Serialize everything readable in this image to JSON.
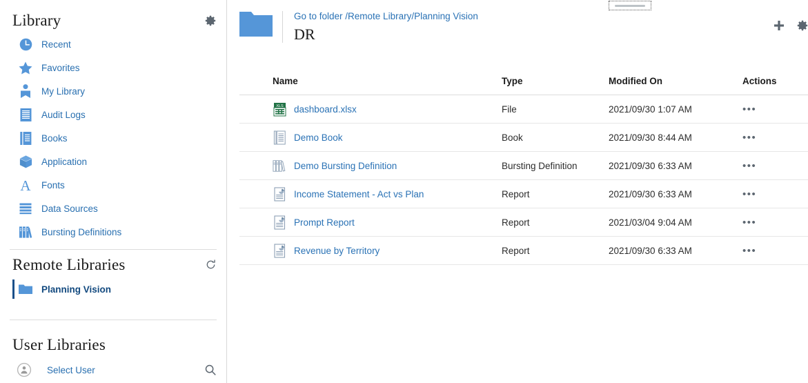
{
  "sidebar": {
    "library": {
      "title": "Library",
      "settings_icon": "gear-icon",
      "items": [
        {
          "label": "Recent",
          "icon": "clock-icon"
        },
        {
          "label": "Favorites",
          "icon": "star-icon"
        },
        {
          "label": "My Library",
          "icon": "user-library-icon"
        },
        {
          "label": "Audit Logs",
          "icon": "lines-document-icon"
        },
        {
          "label": "Books",
          "icon": "book-icon"
        },
        {
          "label": "Application",
          "icon": "cube-icon"
        },
        {
          "label": "Fonts",
          "icon": "letter-a-icon"
        },
        {
          "label": "Data Sources",
          "icon": "stacked-bars-icon"
        },
        {
          "label": "Bursting Definitions",
          "icon": "books-shelf-icon"
        }
      ]
    },
    "remote_libraries": {
      "title": "Remote Libraries",
      "refresh_icon": "refresh-icon",
      "items": [
        {
          "label": "Planning Vision",
          "icon": "folder-icon",
          "selected": true
        }
      ]
    },
    "user_libraries": {
      "title": "User Libraries",
      "select_user_label": "Select User",
      "avatar_icon": "user-circle-icon",
      "search_icon": "search-icon"
    }
  },
  "main": {
    "folder_icon": "folder-icon",
    "breadcrumb": "Go to folder /Remote Library/Planning Vision",
    "title": "DR",
    "actions": {
      "add_label": "plus-icon",
      "settings_label": "gear-icon"
    },
    "table": {
      "columns": [
        "Name",
        "Type",
        "Modified On",
        "Actions"
      ],
      "action_glyph": "•••",
      "rows": [
        {
          "name": "dashboard.xlsx",
          "icon": "xls-file-icon",
          "type": "File",
          "modified": "2021/09/30 1:07 AM"
        },
        {
          "name": "Demo Book",
          "icon": "book-icon",
          "type": "Book",
          "modified": "2021/09/30 8:44 AM"
        },
        {
          "name": "Demo Bursting Definition",
          "icon": "books-shelf-icon",
          "type": "Bursting Definition",
          "modified": "2021/09/30 6:33 AM"
        },
        {
          "name": "Income Statement - Act vs Plan",
          "icon": "report-icon",
          "type": "Report",
          "modified": "2021/09/30 6:33 AM"
        },
        {
          "name": "Prompt Report",
          "icon": "report-icon",
          "type": "Report",
          "modified": "2021/03/04 9:04 AM"
        },
        {
          "name": "Revenue by Territory",
          "icon": "report-icon",
          "type": "Report",
          "modified": "2021/09/30 6:33 AM"
        }
      ]
    }
  },
  "colors": {
    "accent_blue": "#2a72b5",
    "icon_blue": "#5596d8",
    "selected_blue": "#12497f",
    "xls_green": "#217346",
    "gray_icon": "#8da0b5",
    "toolbar_gray": "#5c6670"
  }
}
